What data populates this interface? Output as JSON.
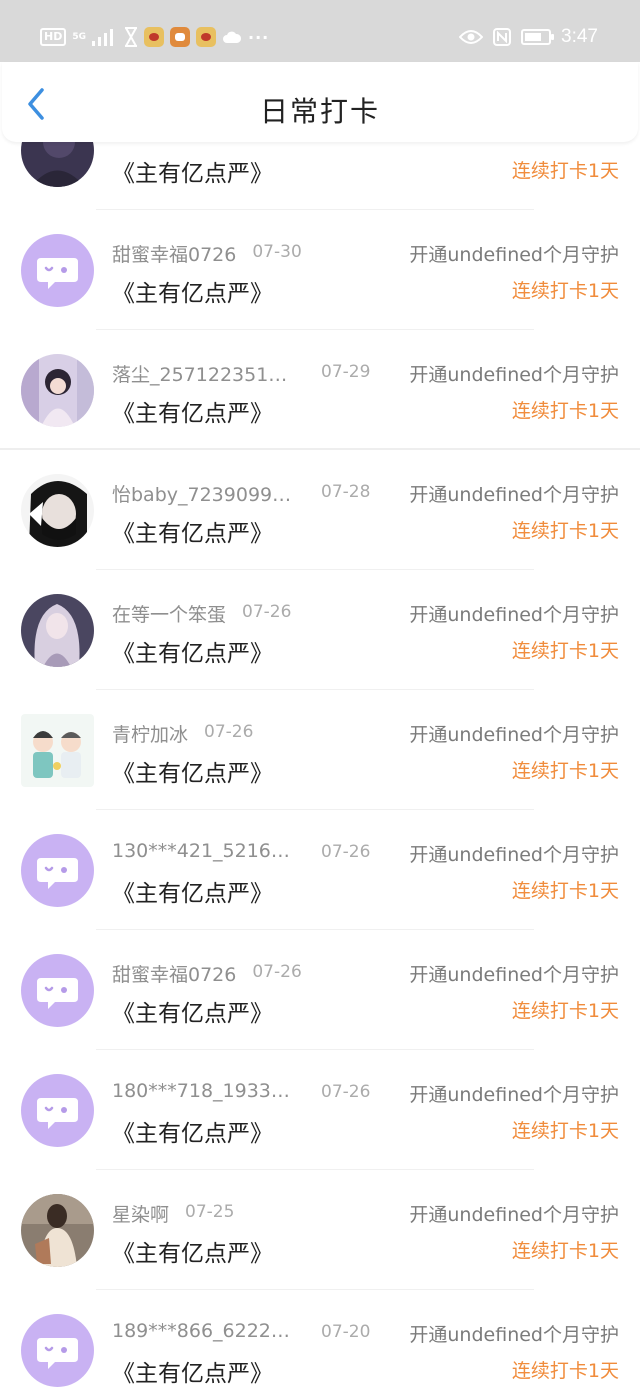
{
  "status_bar": {
    "hd_label": "HD",
    "network_label": "5G",
    "time": "3:47",
    "dots": "···"
  },
  "header": {
    "title": "日常打卡"
  },
  "colors": {
    "accent_blue": "#3d8fe0",
    "streak_orange": "#f08c3c",
    "default_avatar_purple": "#c9b2f3"
  },
  "checkins": [
    {
      "name": "",
      "date": "",
      "book": "《主有亿点严》",
      "action": "",
      "streak": "连续打卡1天",
      "avatar": "photo-dark"
    },
    {
      "name": "甜蜜幸福0726",
      "date": "07-30",
      "book": "《主有亿点严》",
      "action": "开通undefined个月守护",
      "streak": "连续打卡1天",
      "avatar": "default"
    },
    {
      "name": "落尘_2571223516...",
      "date": "07-29",
      "book": "《主有亿点严》",
      "action": "开通undefined个月守护",
      "streak": "连续打卡1天",
      "avatar": "photo-anime-girl"
    },
    {
      "name": "怡baby_72390996...",
      "date": "07-28",
      "book": "《主有亿点严》",
      "action": "开通undefined个月守护",
      "streak": "连续打卡1天",
      "avatar": "photo-masked-face"
    },
    {
      "name": "在等一个笨蛋",
      "date": "07-26",
      "book": "《主有亿点严》",
      "action": "开通undefined个月守护",
      "streak": "连续打卡1天",
      "avatar": "photo-anime-longhair"
    },
    {
      "name": "青柠加冰",
      "date": "07-26",
      "book": "《主有亿点严》",
      "action": "开通undefined个月守护",
      "streak": "连续打卡1天",
      "avatar": "photo-cartoon-couple"
    },
    {
      "name": "130***421_52169...",
      "date": "07-26",
      "book": "《主有亿点严》",
      "action": "开通undefined个月守护",
      "streak": "连续打卡1天",
      "avatar": "default"
    },
    {
      "name": "甜蜜幸福0726",
      "date": "07-26",
      "book": "《主有亿点严》",
      "action": "开通undefined个月守护",
      "streak": "连续打卡1天",
      "avatar": "default"
    },
    {
      "name": "180***718_19331...",
      "date": "07-26",
      "book": "《主有亿点严》",
      "action": "开通undefined个月守护",
      "streak": "连续打卡1天",
      "avatar": "default"
    },
    {
      "name": "星染啊",
      "date": "07-25",
      "book": "《主有亿点严》",
      "action": "开通undefined个月守护",
      "streak": "连续打卡1天",
      "avatar": "photo-girl"
    },
    {
      "name": "189***866_62221...",
      "date": "07-20",
      "book": "《主有亿点严》",
      "action": "开通undefined个月守护",
      "streak": "连续打卡1天",
      "avatar": "default"
    }
  ]
}
